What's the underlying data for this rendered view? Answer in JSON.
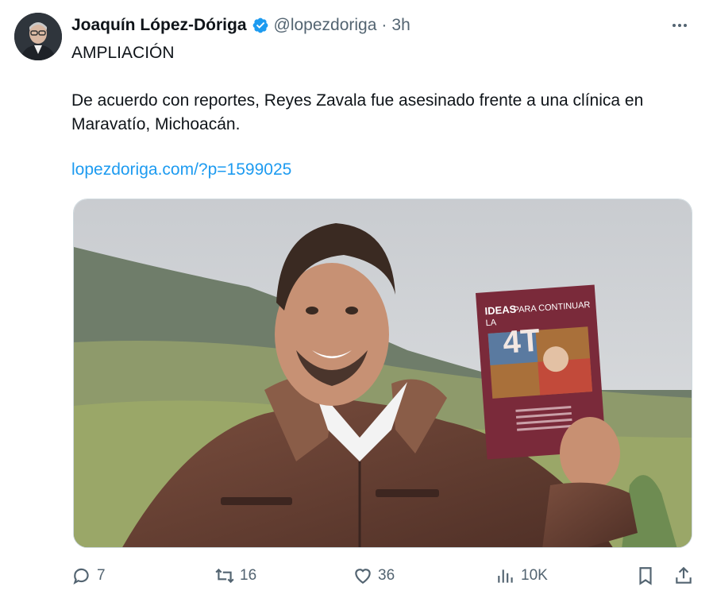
{
  "tweet": {
    "author_name": "Joaquín López-Dóriga",
    "handle": "@lopezdoriga",
    "separator": "·",
    "time": "3h",
    "line1": "AMPLIACIÓN",
    "line2": "De acuerdo con reportes, Reyes Zavala fue asesinado frente a una clínica en Maravatío, Michoacán.",
    "link": "lopezdoriga.com/?p=1599025"
  },
  "media": {
    "book_title_top": "IDEAS",
    "book_title_mid": "PARA CONTINUAR",
    "book_title_la": "LA",
    "book_title_big": "4T"
  },
  "actions": {
    "reply_count": "7",
    "retweet_count": "16",
    "like_count": "36",
    "views_count": "10K"
  },
  "colors": {
    "accent": "#1d9bf0",
    "text": "#0f1419",
    "muted": "#536471",
    "book": "#7a2a3a"
  },
  "icons": [
    "verified-badge-icon",
    "more-icon",
    "reply-icon",
    "retweet-icon",
    "like-icon",
    "views-icon",
    "bookmark-icon",
    "share-icon"
  ]
}
